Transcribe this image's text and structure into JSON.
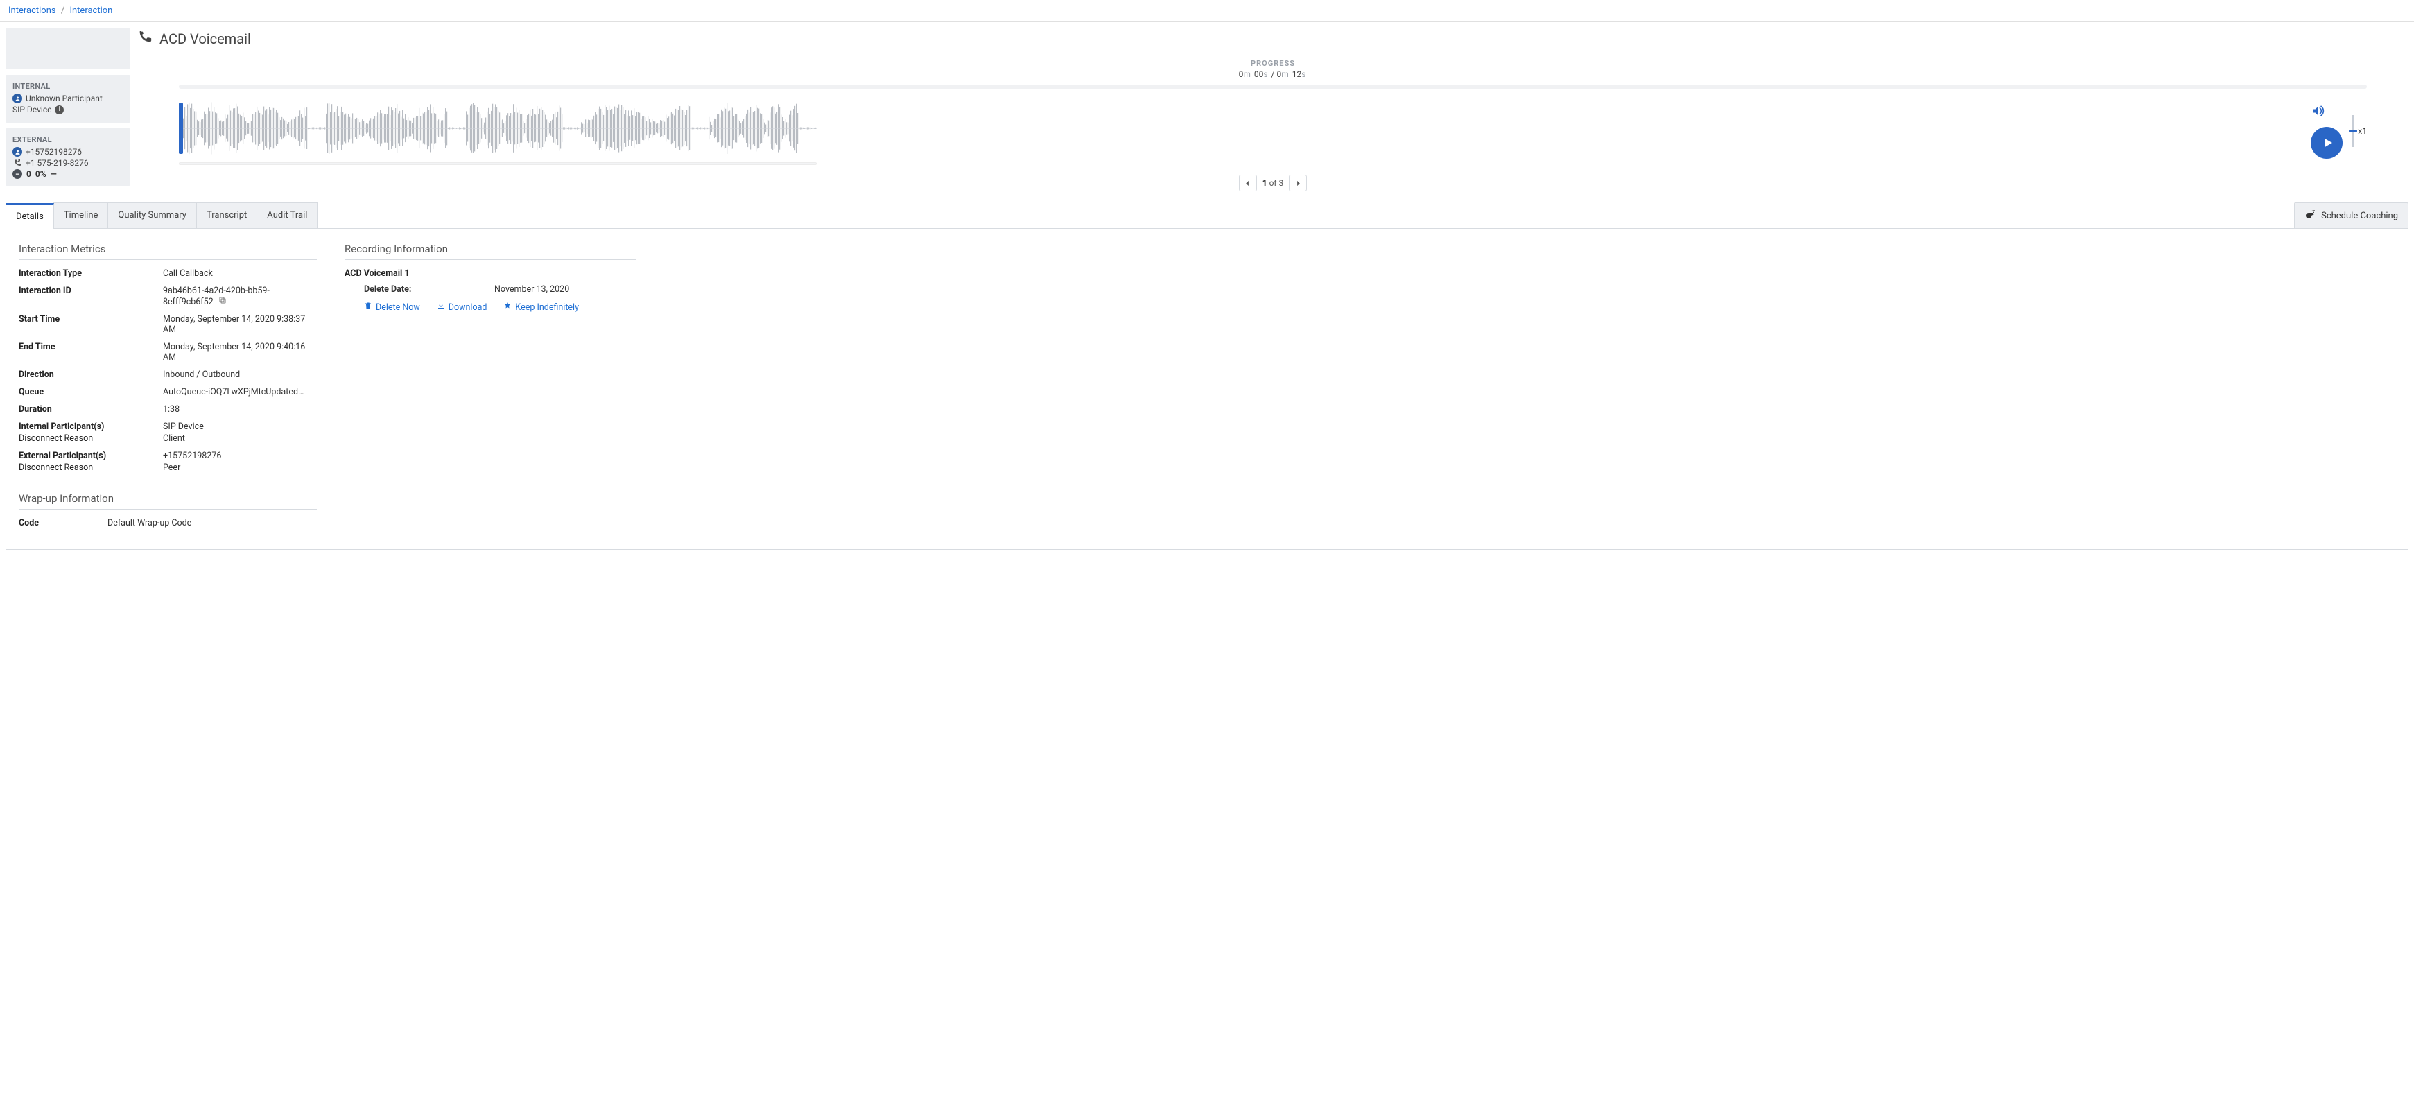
{
  "breadcrumb": {
    "root": "Interactions",
    "current": "Interaction"
  },
  "title": "ACD Voicemail",
  "participants": {
    "internal": {
      "label": "INTERNAL",
      "name": "Unknown Participant",
      "device": "SIP Device"
    },
    "external": {
      "label": "EXTERNAL",
      "phone_raw": "+15752198276",
      "phone_fmt": "+1 575-219-8276",
      "stat_a": "0",
      "stat_b": "0%",
      "stat_c": "—"
    }
  },
  "player": {
    "progress_label": "PROGRESS",
    "elapsed_m": "0",
    "elapsed_s": "00",
    "total_m": "0",
    "total_s": "12",
    "speed": "x1",
    "pager": {
      "current": "1",
      "of": "of",
      "total": "3"
    }
  },
  "tabs": {
    "details": "Details",
    "timeline": "Timeline",
    "quality": "Quality Summary",
    "transcript": "Transcript",
    "audit": "Audit Trail"
  },
  "coaching_btn": "Schedule Coaching",
  "metrics": {
    "section": "Interaction Metrics",
    "type_k": "Interaction Type",
    "type_v": "Call    Callback",
    "id_k": "Interaction ID",
    "id_v": "9ab46b61-4a2d-420b-bb59-8efff9cb6f52",
    "start_k": "Start Time",
    "start_v": "Monday, September 14, 2020 9:38:37 AM",
    "end_k": "End Time",
    "end_v": "Monday, September 14, 2020 9:40:16 AM",
    "dir_k": "Direction",
    "dir_v": "Inbound / Outbound",
    "queue_k": "Queue",
    "queue_v": "AutoQueue-iOQ7LwXPjMtcUpdated…",
    "dur_k": "Duration",
    "dur_v": "1:38",
    "intp_k": "Internal Participant(s)",
    "intp_k2": "Disconnect Reason",
    "intp_v": "SIP Device",
    "intp_v2": "Client",
    "extp_k": "External Participant(s)",
    "extp_k2": "Disconnect Reason",
    "extp_v": "+15752198276",
    "extp_v2": "Peer"
  },
  "recording": {
    "section": "Recording Information",
    "name": "ACD Voicemail 1",
    "delete_k": "Delete Date:",
    "delete_v": "November 13, 2020",
    "delete_now": "Delete Now",
    "download": "Download",
    "keep": "Keep Indefinitely"
  },
  "wrapup": {
    "section": "Wrap-up Information",
    "code_k": "Code",
    "code_v": "Default Wrap-up Code"
  }
}
